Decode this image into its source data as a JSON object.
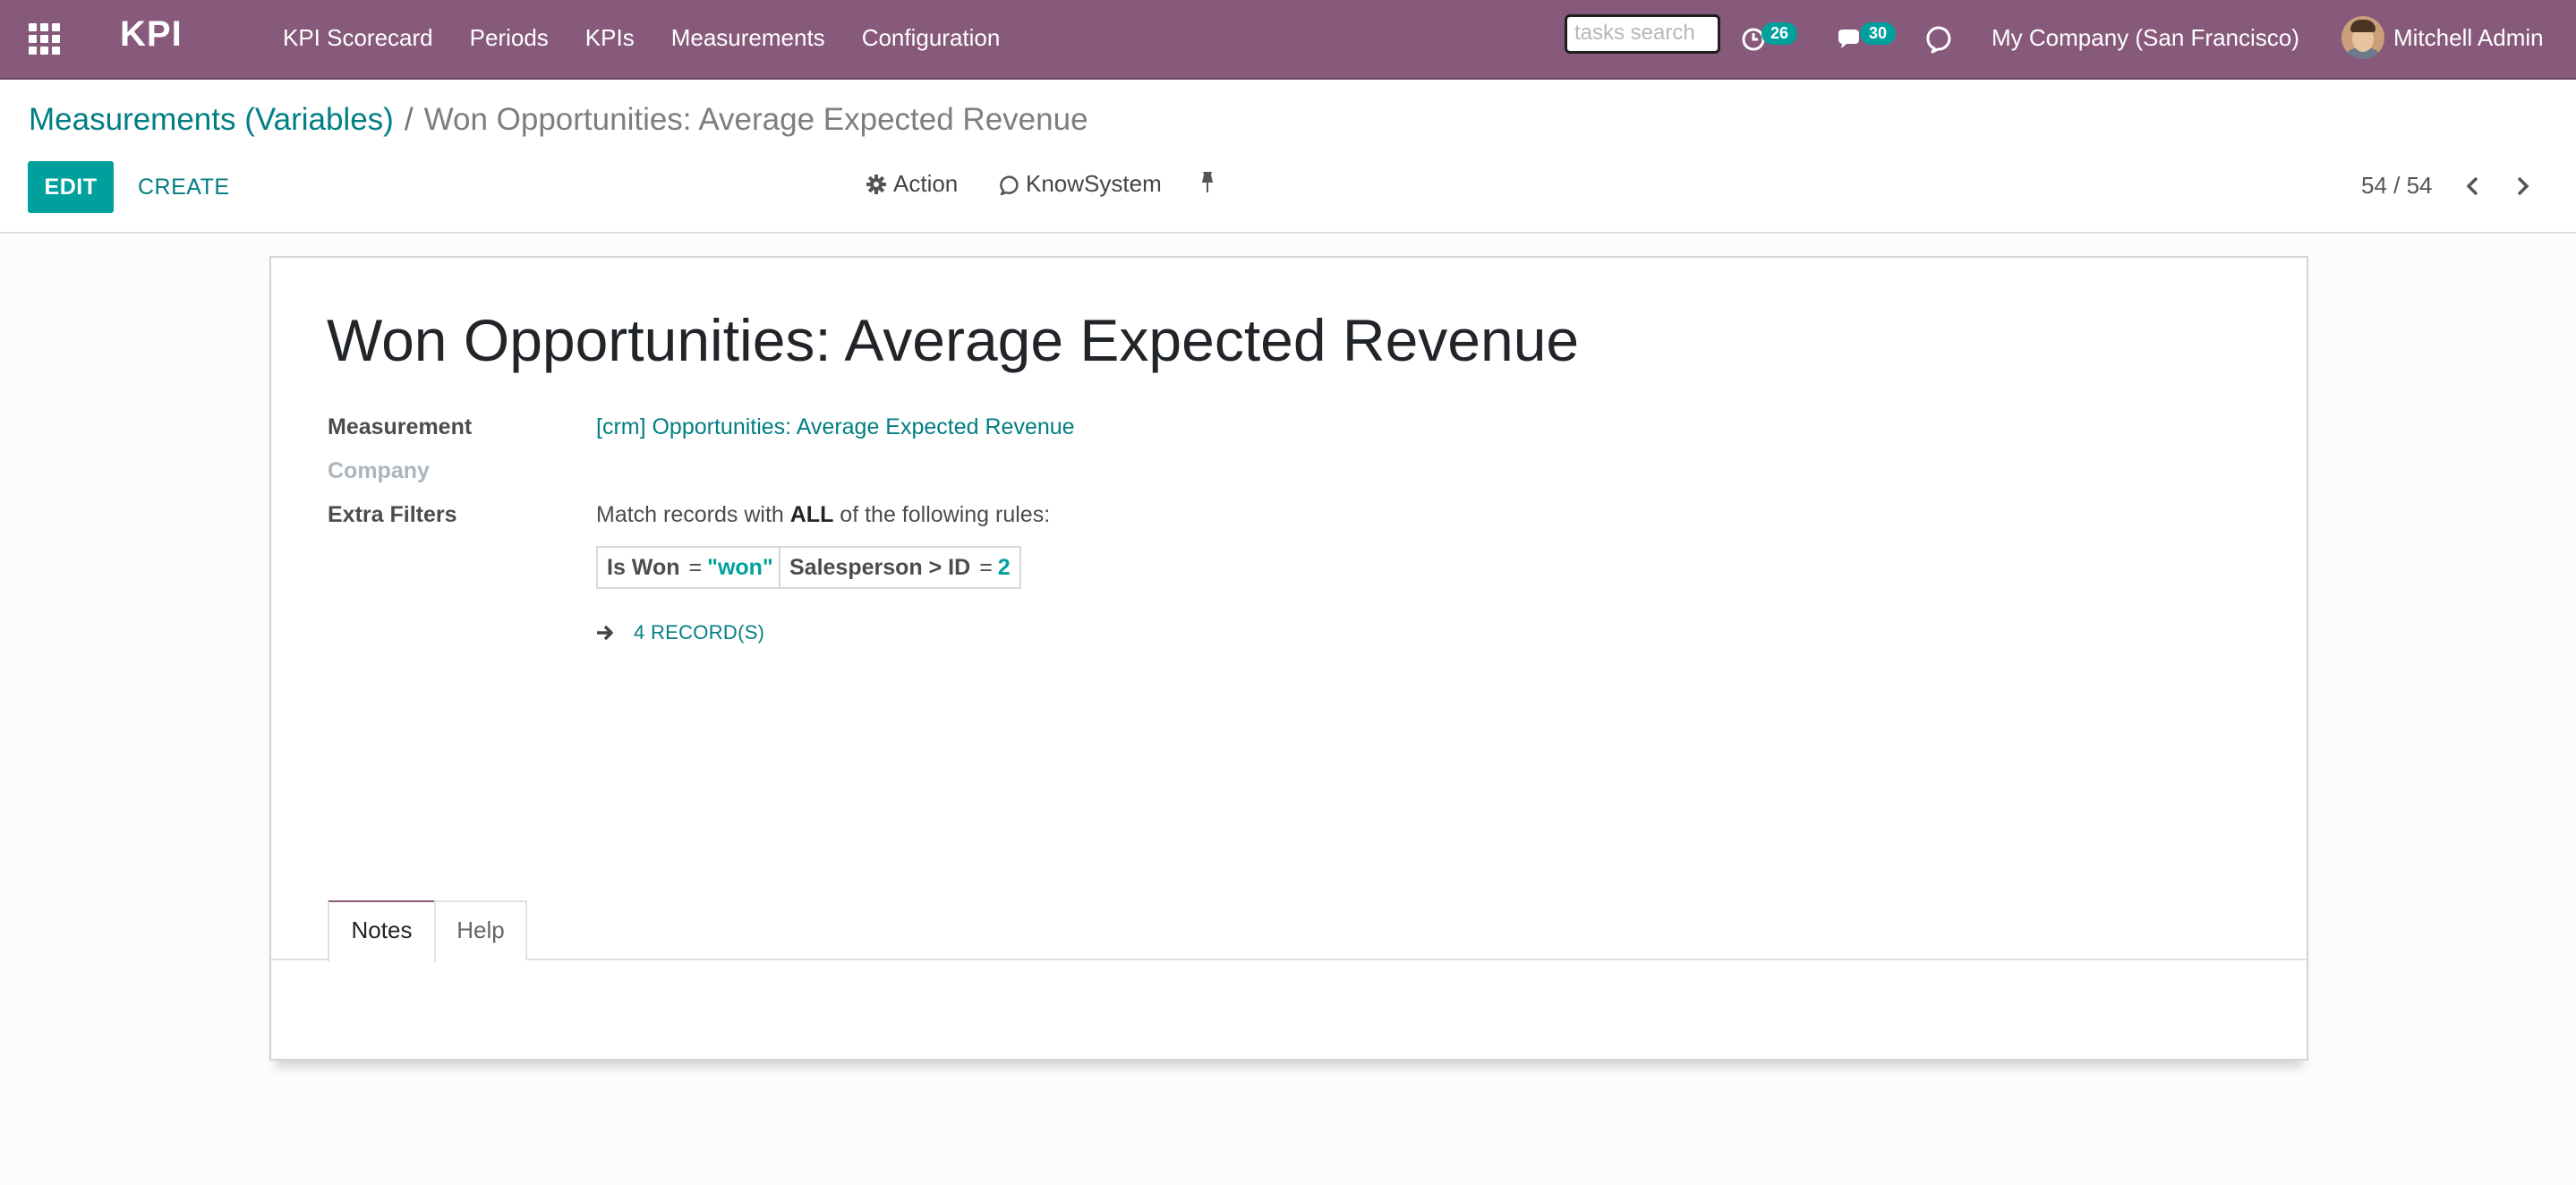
{
  "navbar": {
    "brand": "KPI",
    "menu": [
      "KPI Scorecard",
      "Periods",
      "KPIs",
      "Measurements",
      "Configuration"
    ],
    "search_placeholder": "tasks search",
    "activity_count": "26",
    "messages_count": "30",
    "company": "My Company (San Francisco)",
    "user": "Mitchell Admin"
  },
  "control": {
    "breadcrumb_parent": "Measurements (Variables)",
    "breadcrumb_sep": "/",
    "breadcrumb_current": "Won Opportunities: Average Expected Revenue",
    "edit_label": "EDIT",
    "create_label": "CREATE",
    "action_label": "Action",
    "knowsystem_label": "KnowSystem",
    "pager": "54 / 54"
  },
  "form": {
    "title": "Won Opportunities: Average Expected Revenue",
    "measurement_label": "Measurement",
    "measurement_value": "[crm] Opportunities: Average Expected Revenue",
    "company_label": "Company",
    "filters_label": "Extra Filters",
    "rules_prefix": "Match records with ",
    "rules_bold": "ALL",
    "rules_suffix": " of the following rules:",
    "rules": [
      {
        "field": "Is Won",
        "op": "=",
        "value": "\"won\""
      },
      {
        "field": "Salesperson > ID",
        "op": "=",
        "value": "2"
      }
    ],
    "records_label": "4 RECORD(S)",
    "tabs": [
      "Notes",
      "Help"
    ]
  },
  "colors": {
    "navbar": "#875a7b",
    "primary": "#00a09d",
    "link": "#017e84"
  }
}
